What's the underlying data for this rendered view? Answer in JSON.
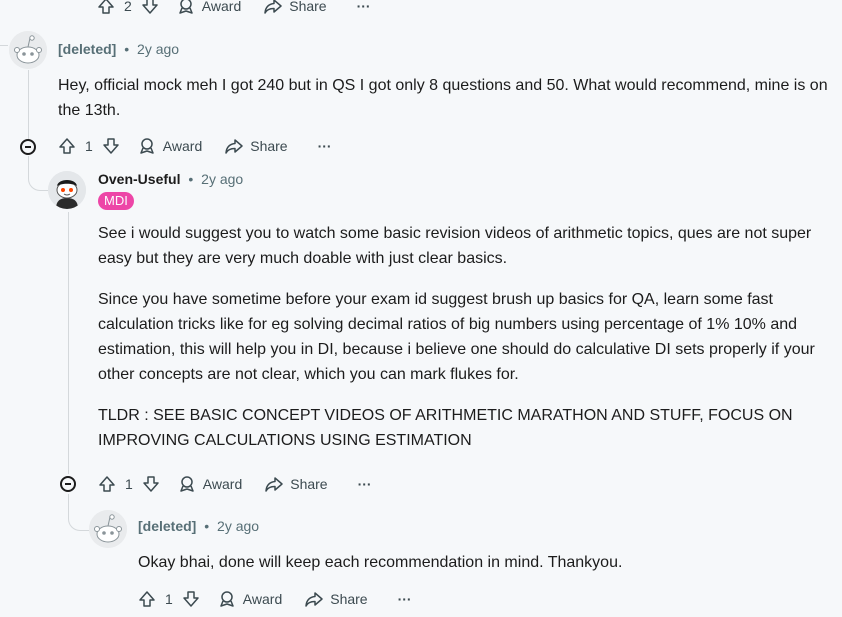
{
  "top_bar": {
    "votes": "2",
    "award": "Award",
    "share": "Share",
    "more": "···"
  },
  "comments": [
    {
      "author": "[deleted]",
      "time": "2y ago",
      "body": [
        "Hey, official mock meh I got 240 but in QS I got only 8 questions and 50. What would recommend, mine is on the 13th."
      ],
      "votes": "1",
      "award": "Award",
      "share": "Share",
      "more": "···"
    },
    {
      "author": "Oven-Useful",
      "time": "2y ago",
      "flair": "MDI",
      "body": [
        "See i would suggest you to watch some basic revision videos of arithmetic topics, ques are not super easy but they are very much doable with just clear basics.",
        "Since you have sometime before your exam id suggest brush up basics for QA, learn some fast calculation tricks like for eg solving decimal ratios of big numbers using percentage of 1% 10% and estimation, this will help you in DI, because i believe one should do calculative DI sets properly if your other concepts are not clear, which you can mark flukes for.",
        "TLDR : SEE BASIC CONCEPT VIDEOS OF ARITHMETIC MARATHON AND STUFF, FOCUS ON IMPROVING CALCULATIONS USING ESTIMATION"
      ],
      "votes": "1",
      "award": "Award",
      "share": "Share",
      "more": "···"
    },
    {
      "author": "[deleted]",
      "time": "2y ago",
      "body": [
        "Okay bhai, done will keep each recommendation in mind. Thankyou."
      ],
      "votes": "1",
      "award": "Award",
      "share": "Share",
      "more": "···"
    }
  ],
  "separator": "•"
}
